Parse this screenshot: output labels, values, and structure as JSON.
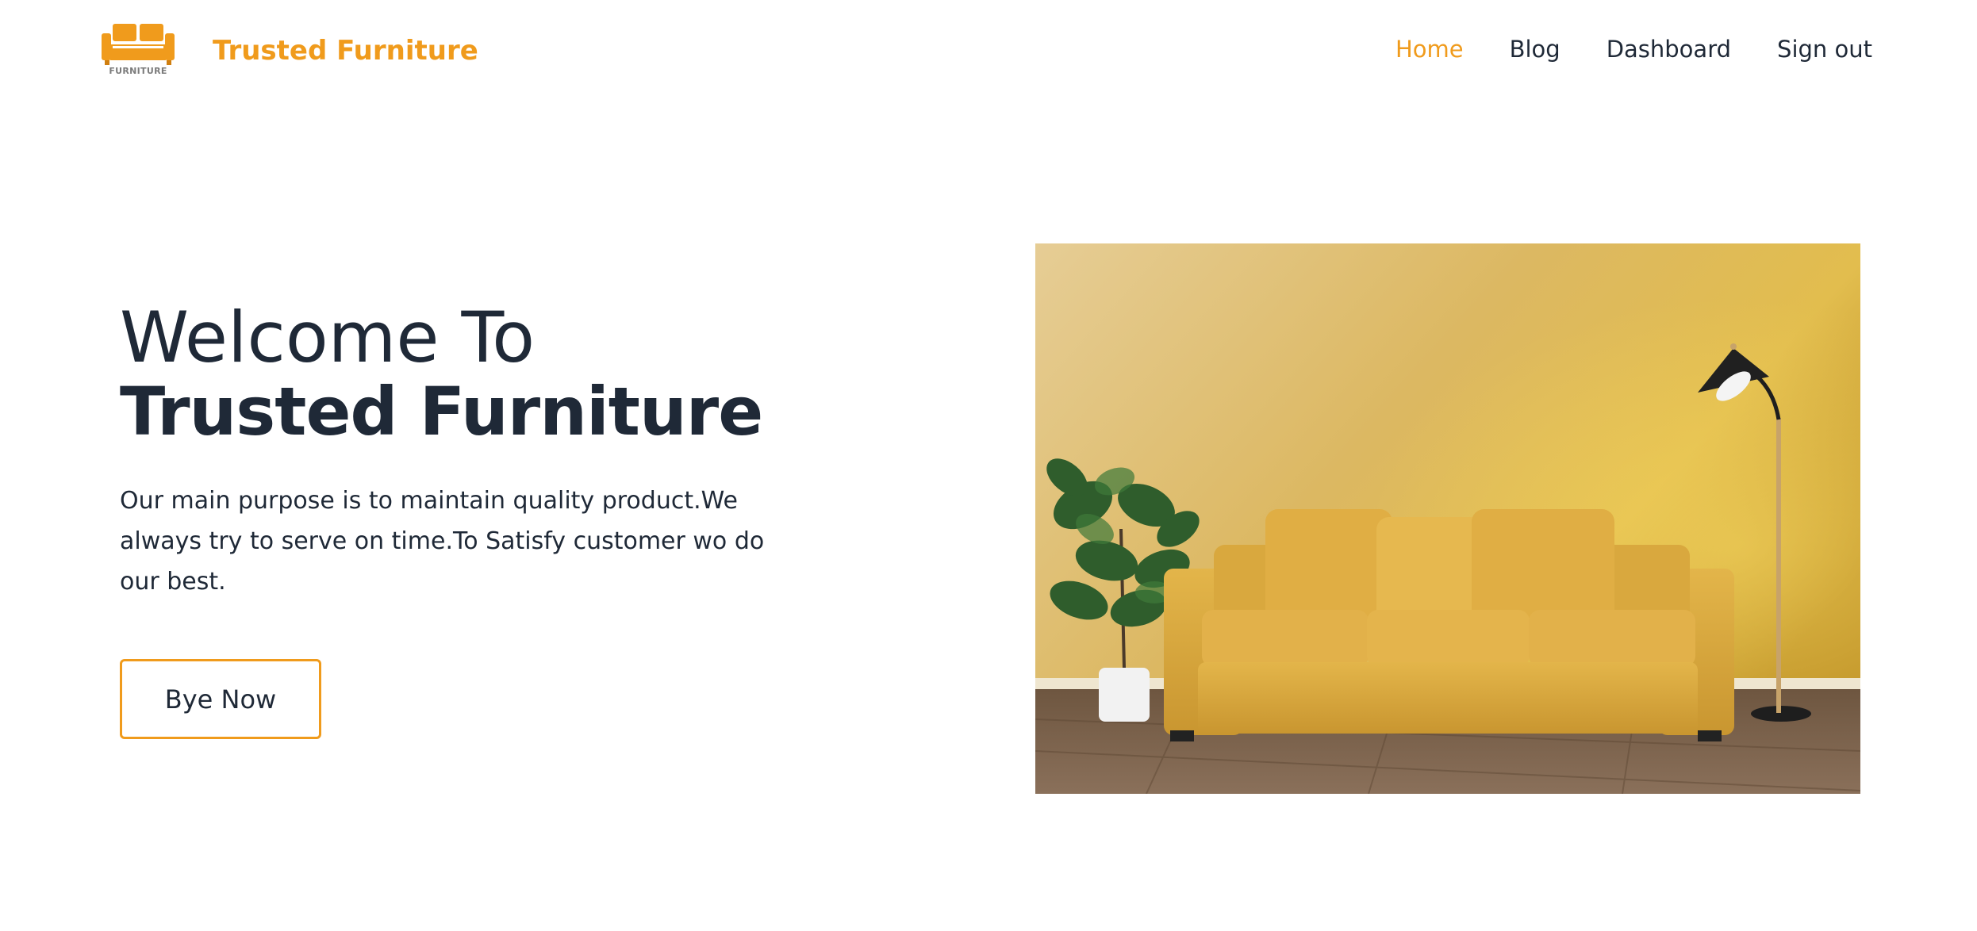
{
  "header": {
    "logo_text": "FURNITURE",
    "brand": "Trusted Furniture",
    "nav": [
      {
        "label": "Home",
        "active": true
      },
      {
        "label": "Blog",
        "active": false
      },
      {
        "label": "Dashboard",
        "active": false
      },
      {
        "label": "Sign out",
        "active": false
      }
    ]
  },
  "hero": {
    "welcome": "Welcome To",
    "title": "Trusted Furniture",
    "description": "Our main purpose is to maintain quality product.We always try to serve on time.To Satisfy customer wo do our best.",
    "cta_label": "Bye Now"
  },
  "theme": {
    "accent": "#f09b1c",
    "text": "#1f2937"
  }
}
